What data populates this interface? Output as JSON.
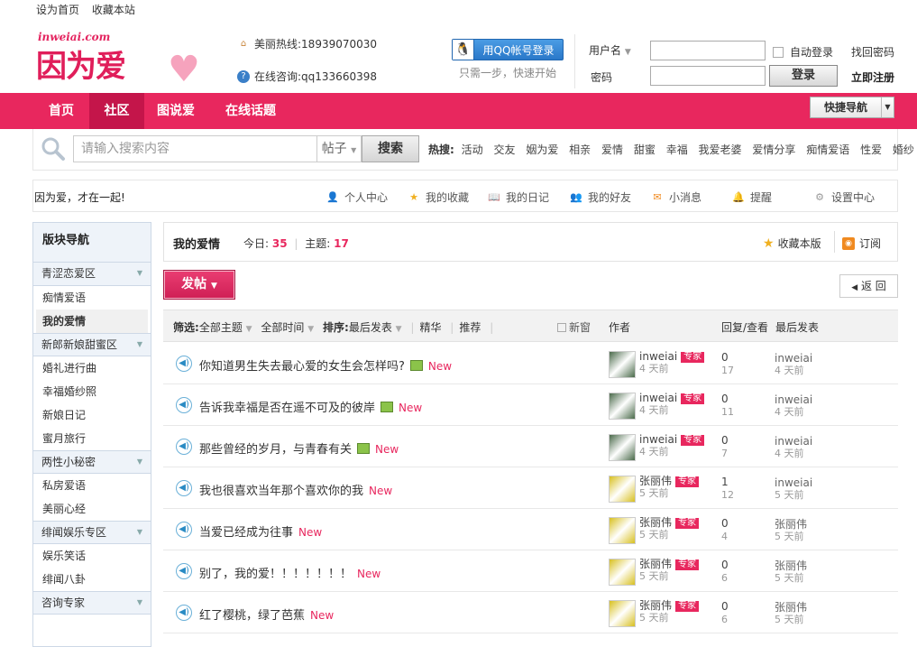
{
  "top_links": [
    "设为首页",
    "收藏本站"
  ],
  "logo": {
    "small": "inweiai.com",
    "big": "因为爱"
  },
  "contact": {
    "hotline": "美丽热线:18939070030",
    "consult": "在线咨询:qq133660398"
  },
  "qq_login": {
    "label": "用QQ帐号登录",
    "sub": "只需一步，快速开始"
  },
  "login": {
    "username_label": "用户名",
    "password_label": "密码",
    "auto_login": "自动登录",
    "forgot": "找回密码",
    "login_button": "登录",
    "register": "立即注册"
  },
  "nav": {
    "items": [
      "首页",
      "社区",
      "图说爱",
      "在线话题"
    ],
    "quick_nav": "快捷导航"
  },
  "search": {
    "placeholder": "请输入搜索内容",
    "type": "帖子",
    "button": "搜索",
    "hot_label": "热搜:",
    "hot_words": [
      "活动",
      "交友",
      "姻为爱",
      "相亲",
      "爱情",
      "甜蜜",
      "幸福",
      "我爱老婆",
      "爱情分享",
      "痴情爱语",
      "性爱",
      "婚纱"
    ]
  },
  "user_bar": {
    "slogan": "因为爱，才在一起!",
    "menu": [
      "个人中心",
      "我的收藏",
      "我的日记",
      "我的好友",
      "小消息",
      "提醒",
      "设置中心"
    ]
  },
  "sidebar": {
    "head": "版块导航",
    "groups": [
      {
        "title": "青涩恋爱区",
        "items": [
          "痴情爱语",
          "我的爱情"
        ]
      },
      {
        "title": "新郎新娘甜蜜区",
        "items": [
          "婚礼进行曲",
          "幸福婚纱照",
          "新娘日记",
          "蜜月旅行"
        ]
      },
      {
        "title": "两性小秘密",
        "items": [
          "私房爱语",
          "美丽心经"
        ]
      },
      {
        "title": "绯闻娱乐专区",
        "items": [
          "娱乐笑话",
          "绯闻八卦"
        ]
      },
      {
        "title": "咨询专家",
        "items": []
      }
    ]
  },
  "forum": {
    "title": "我的爱情",
    "today_label": "今日:",
    "today": "35",
    "topics_label": "主题:",
    "topics": "17",
    "fav": "收藏本版",
    "rss": "订阅",
    "post_button": "发帖",
    "back": "返 回"
  },
  "table_head": {
    "filter": "筛选:",
    "all_topics": "全部主题",
    "all_time": "全部时间",
    "sort": "排序:",
    "last_post": "最后发表",
    "digest": "精华",
    "recommend": "推荐",
    "new_window": "新窗",
    "author": "作者",
    "reply_view": "回复/查看",
    "last": "最后发表"
  },
  "threads": [
    {
      "title": "你知道男生失去最心爱的女生会怎样吗?",
      "img": true,
      "new": "New",
      "author": "inweiai",
      "badge": "专家",
      "ago": "4 天前",
      "replies": "0",
      "views": "17",
      "last_user": "inweiai",
      "last_ago": "4 天前",
      "avatar": "#4a6a4a"
    },
    {
      "title": "告诉我幸福是否在遥不可及的彼岸",
      "img": true,
      "new": "New",
      "author": "inweiai",
      "badge": "专家",
      "ago": "4 天前",
      "replies": "0",
      "views": "11",
      "last_user": "inweiai",
      "last_ago": "4 天前",
      "avatar": "#4a6a4a"
    },
    {
      "title": "那些曾经的岁月，与青春有关",
      "img": true,
      "new": "New",
      "author": "inweiai",
      "badge": "专家",
      "ago": "4 天前",
      "replies": "0",
      "views": "7",
      "last_user": "inweiai",
      "last_ago": "4 天前",
      "avatar": "#4a6a4a"
    },
    {
      "title": "我也很喜欢当年那个喜欢你的我",
      "img": false,
      "new": "New",
      "author": "张丽伟",
      "badge": "专家",
      "ago": "5 天前",
      "replies": "1",
      "views": "12",
      "last_user": "inweiai",
      "last_ago": "5 天前",
      "avatar": "#d8c020"
    },
    {
      "title": "当爱已经成为往事",
      "img": false,
      "new": "New",
      "author": "张丽伟",
      "badge": "专家",
      "ago": "5 天前",
      "replies": "0",
      "views": "4",
      "last_user": "张丽伟",
      "last_ago": "5 天前",
      "avatar": "#d8c020"
    },
    {
      "title": "别了，我的爱！！！！！！！",
      "img": false,
      "new": "New",
      "author": "张丽伟",
      "badge": "专家",
      "ago": "5 天前",
      "replies": "0",
      "views": "6",
      "last_user": "张丽伟",
      "last_ago": "5 天前",
      "avatar": "#d8c020"
    },
    {
      "title": "红了樱桃，绿了芭蕉",
      "img": false,
      "new": "New",
      "author": "张丽伟",
      "badge": "专家",
      "ago": "5 天前",
      "replies": "0",
      "views": "6",
      "last_user": "张丽伟",
      "last_ago": "5 天前",
      "avatar": "#d8c020"
    }
  ],
  "colors": {
    "brand": "#e8275e",
    "nav_active": "#c4154a",
    "sidebar_bg": "#eef3f9"
  }
}
